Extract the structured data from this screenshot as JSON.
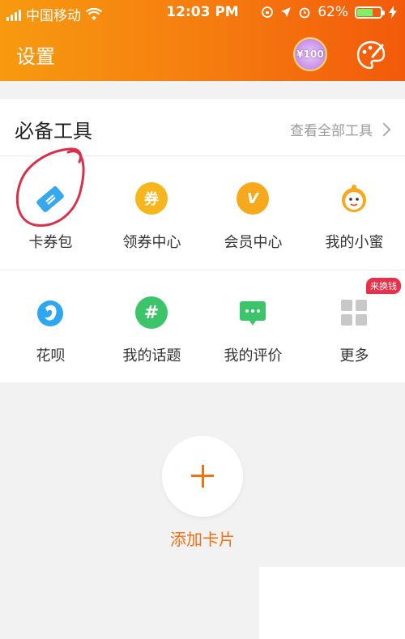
{
  "status_bar": {
    "carrier": "中国移动",
    "time": "12:03 PM",
    "battery": "62%",
    "battery_level": 0.62
  },
  "header": {
    "title": "设置",
    "vip_badge": "¥100"
  },
  "tools": {
    "section_title": "必备工具",
    "see_all": "查看全部工具",
    "row1": [
      {
        "label": "卡券包",
        "icon": "card-coupon-icon"
      },
      {
        "label": "领券中心",
        "icon": "coupon-center-icon",
        "glyph": "券"
      },
      {
        "label": "会员中心",
        "icon": "member-center-icon",
        "glyph": "V"
      },
      {
        "label": "我的小蜜",
        "icon": "assistant-icon"
      }
    ],
    "row2": [
      {
        "label": "花呗",
        "icon": "huabei-icon"
      },
      {
        "label": "我的话题",
        "icon": "topic-icon",
        "glyph": "#"
      },
      {
        "label": "我的评价",
        "icon": "review-icon"
      },
      {
        "label": "更多",
        "icon": "more-grid-icon"
      }
    ],
    "more_badge": "来换钱"
  },
  "add_card": {
    "label": "添加卡片"
  },
  "colors": {
    "accent": "#f36f12",
    "header_start": "#f79a10",
    "header_end": "#f25a0a"
  }
}
